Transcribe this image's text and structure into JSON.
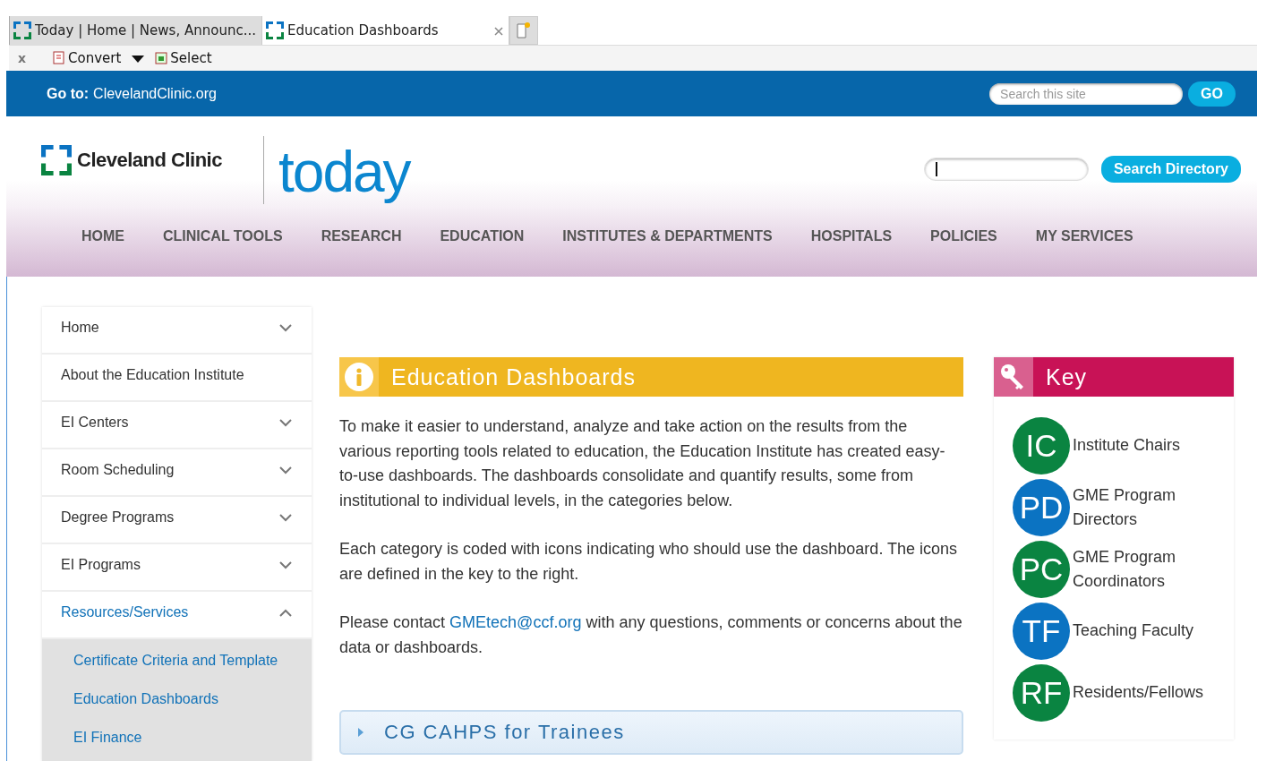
{
  "browser": {
    "tabs": [
      {
        "label": "Today | Home | News, Announc...",
        "selected": false
      },
      {
        "label": "Education Dashboards",
        "selected": true
      }
    ],
    "toolbar": {
      "close": "x",
      "convert": "Convert",
      "select": "Select"
    }
  },
  "top_bar": {
    "goto_label": "Go to:",
    "goto_link": "ClevelandClinic.org",
    "search": {
      "placeholder": "Search this site"
    },
    "go_button": "GO"
  },
  "header": {
    "logo_text": "Cleveland Clinic",
    "site_name": "today",
    "directory_button": "Search Directory"
  },
  "nav": {
    "items": [
      "HOME",
      "CLINICAL TOOLS",
      "RESEARCH",
      "EDUCATION",
      "INSTITUTES & DEPARTMENTS",
      "HOSPITALS",
      "POLICIES",
      "MY SERVICES"
    ]
  },
  "sidebar": {
    "items": [
      {
        "label": "Home",
        "kind": "toggle",
        "expanded": false,
        "selected": false
      },
      {
        "label": "About the Education Institute",
        "kind": "link",
        "selected": false
      },
      {
        "label": "EI Centers",
        "kind": "toggle",
        "expanded": false,
        "selected": false
      },
      {
        "label": "Room Scheduling",
        "kind": "toggle",
        "expanded": false,
        "selected": false
      },
      {
        "label": "Degree Programs",
        "kind": "toggle",
        "expanded": false,
        "selected": false
      },
      {
        "label": "EI Programs",
        "kind": "toggle",
        "expanded": false,
        "selected": false
      },
      {
        "label": "Resources/Services",
        "kind": "toggle",
        "expanded": true,
        "selected": true,
        "children": [
          {
            "label": "Certificate Criteria and Template"
          },
          {
            "label": "Education Dashboards"
          },
          {
            "label": "EI Finance"
          }
        ]
      }
    ]
  },
  "article": {
    "title": "Education Dashboards",
    "paragraphs": [
      {
        "text": "To make it easier to understand, analyze and take action on the results from the various reporting tools related to education, the Education Institute has created easy-to-use dashboards. The dashboards consolidate and quantify results, some from institutional to individual levels, in the categories below."
      },
      {
        "text": "Each category is coded with icons indicating who should use the dashboard. The icons are defined in the key to the right."
      },
      {
        "text": "Please contact",
        "link": "GMEtech@ccf.org",
        "after": "with any questions, comments or concerns about the data or dashboards."
      }
    ],
    "sections": [
      {
        "title": "CG CAHPS for Trainees",
        "expanded": false
      }
    ]
  },
  "key": {
    "title": "Key",
    "entries": [
      {
        "abbr": "IC",
        "label": "Institute Chairs",
        "color": "#0a8441"
      },
      {
        "abbr": "PD",
        "label": "GME Program Directors",
        "color": "#0b73c2"
      },
      {
        "abbr": "PC",
        "label": "GME Program Coordinators",
        "color": "#0a8441"
      },
      {
        "abbr": "TF",
        "label": "Teaching Faculty",
        "color": "#0b73c2"
      },
      {
        "abbr": "RF",
        "label": "Residents/Fellows",
        "color": "#0a8441"
      }
    ]
  }
}
